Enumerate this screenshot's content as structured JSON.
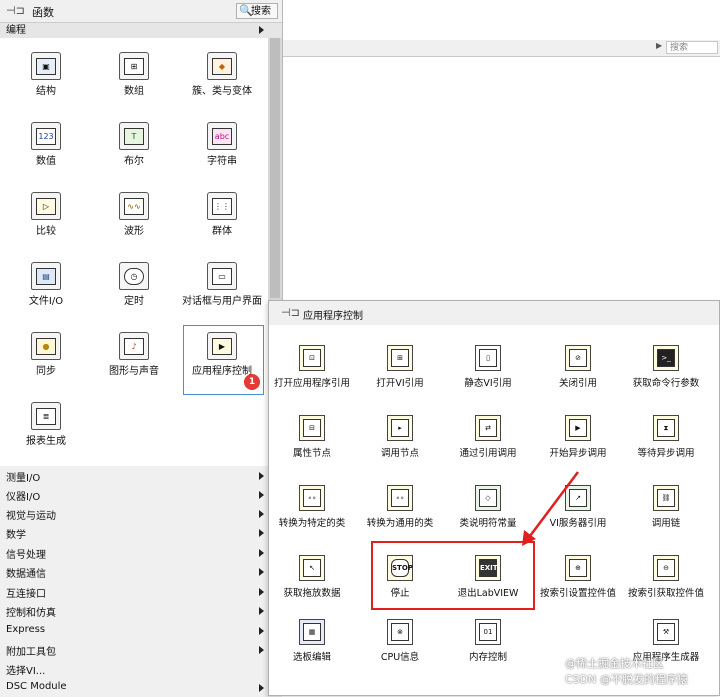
{
  "background_window": {
    "search_placeholder": "搜索"
  },
  "functions_palette": {
    "title": "函数",
    "search_label": "搜索",
    "category": "编程",
    "items": [
      {
        "label": "结构",
        "icon": "structures-icon"
      },
      {
        "label": "数组",
        "icon": "array-icon"
      },
      {
        "label": "簇、类与变体",
        "icon": "cluster-icon"
      },
      {
        "label": "数值",
        "icon": "numeric-icon"
      },
      {
        "label": "布尔",
        "icon": "boolean-icon"
      },
      {
        "label": "字符串",
        "icon": "string-icon"
      },
      {
        "label": "比较",
        "icon": "comparison-icon"
      },
      {
        "label": "波形",
        "icon": "waveform-icon"
      },
      {
        "label": "群体",
        "icon": "collection-icon"
      },
      {
        "label": "文件I/O",
        "icon": "file-io-icon"
      },
      {
        "label": "定时",
        "icon": "timing-icon"
      },
      {
        "label": "对话框与用户界面",
        "icon": "dialog-icon"
      },
      {
        "label": "同步",
        "icon": "synchronization-icon"
      },
      {
        "label": "图形与声音",
        "icon": "graphics-sound-icon"
      },
      {
        "label": "应用程序控制",
        "icon": "app-control-icon"
      },
      {
        "label": "报表生成",
        "icon": "report-icon"
      }
    ],
    "badge": "1",
    "categories": [
      "测量I/O",
      "仪器I/O",
      "视觉与运动",
      "数学",
      "信号处理",
      "数据通信",
      "互连接口",
      "控制和仿真",
      "Express",
      "附加工具包",
      "选择VI...",
      "DSC Module"
    ]
  },
  "sub_palette": {
    "title": "应用程序控制",
    "items": [
      {
        "label": "打开应用程序引用"
      },
      {
        "label": "打开VI引用"
      },
      {
        "label": "静态VI引用"
      },
      {
        "label": "关闭引用"
      },
      {
        "label": "获取命令行参数"
      },
      {
        "label": "属性节点"
      },
      {
        "label": "调用节点"
      },
      {
        "label": "通过引用调用"
      },
      {
        "label": "开始异步调用"
      },
      {
        "label": "等待异步调用"
      },
      {
        "label": "转换为特定的类"
      },
      {
        "label": "转换为通用的类"
      },
      {
        "label": "类说明符常量"
      },
      {
        "label": "VI服务器引用"
      },
      {
        "label": "调用链"
      },
      {
        "label": "获取拖放数据"
      },
      {
        "label": "停止",
        "glyph": "STOP"
      },
      {
        "label": "退出LabVIEW",
        "glyph": "EXIT"
      },
      {
        "label": "按索引设置控件值"
      },
      {
        "label": "按索引获取控件值"
      },
      {
        "label": "选板编辑"
      },
      {
        "label": "CPU信息"
      },
      {
        "label": "内存控制"
      },
      {
        "label": "应用程序生成器"
      }
    ]
  },
  "watermark": [
    "@稀土掘金技术社区",
    "CSDN @不脱发的程序猿"
  ],
  "colors": {
    "highlight": "#e02020",
    "selection": "#4a90d9",
    "badge": "#e53935"
  }
}
